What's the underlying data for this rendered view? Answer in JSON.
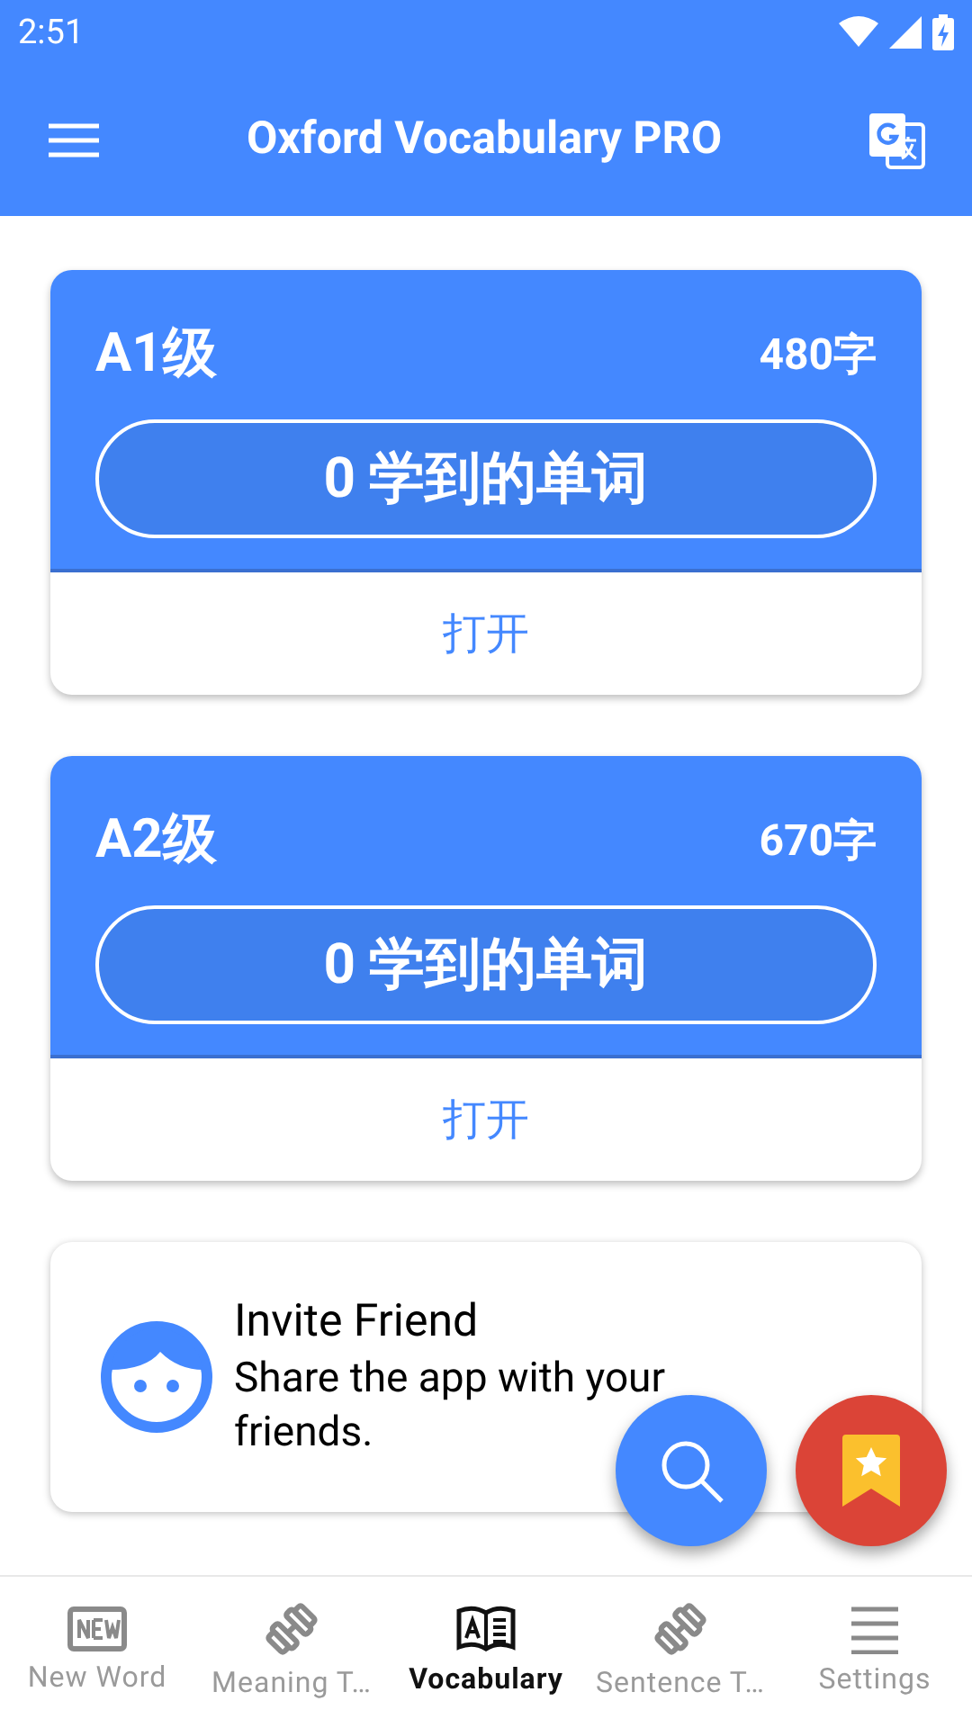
{
  "status_bar": {
    "time": "2:51"
  },
  "app_bar": {
    "title": "Oxford Vocabulary PRO"
  },
  "levels": [
    {
      "name": "A1级",
      "count": "480字",
      "learned": "0 学到的单词",
      "open": "打开"
    },
    {
      "name": "A2级",
      "count": "670字",
      "learned": "0 学到的单词",
      "open": "打开"
    }
  ],
  "invite": {
    "title": "Invite Friend",
    "text": "Share the app with your friends."
  },
  "bottom_nav": [
    {
      "label": "New Word",
      "kind": "new",
      "selected": false
    },
    {
      "label": "Meaning T…",
      "kind": "dumbbell",
      "selected": false
    },
    {
      "label": "Vocabulary",
      "kind": "book",
      "selected": true
    },
    {
      "label": "Sentence T…",
      "kind": "dumbbell",
      "selected": false
    },
    {
      "label": "Settings",
      "kind": "menu",
      "selected": false
    }
  ]
}
